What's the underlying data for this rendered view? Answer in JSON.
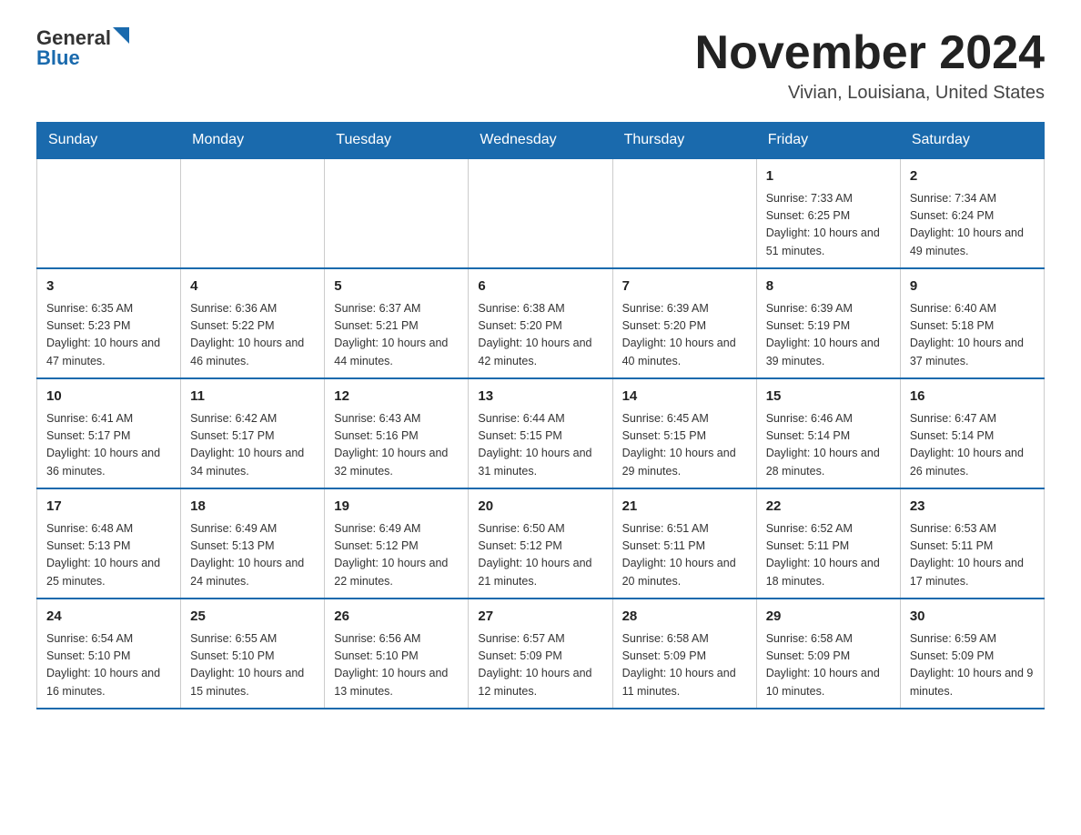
{
  "header": {
    "logo": {
      "general": "General",
      "blue": "Blue",
      "alt": "GeneralBlue logo"
    },
    "title": "November 2024",
    "location": "Vivian, Louisiana, United States"
  },
  "calendar": {
    "days_of_week": [
      "Sunday",
      "Monday",
      "Tuesday",
      "Wednesday",
      "Thursday",
      "Friday",
      "Saturday"
    ],
    "weeks": [
      [
        {
          "day": "",
          "info": ""
        },
        {
          "day": "",
          "info": ""
        },
        {
          "day": "",
          "info": ""
        },
        {
          "day": "",
          "info": ""
        },
        {
          "day": "",
          "info": ""
        },
        {
          "day": "1",
          "info": "Sunrise: 7:33 AM\nSunset: 6:25 PM\nDaylight: 10 hours and 51 minutes."
        },
        {
          "day": "2",
          "info": "Sunrise: 7:34 AM\nSunset: 6:24 PM\nDaylight: 10 hours and 49 minutes."
        }
      ],
      [
        {
          "day": "3",
          "info": "Sunrise: 6:35 AM\nSunset: 5:23 PM\nDaylight: 10 hours and 47 minutes."
        },
        {
          "day": "4",
          "info": "Sunrise: 6:36 AM\nSunset: 5:22 PM\nDaylight: 10 hours and 46 minutes."
        },
        {
          "day": "5",
          "info": "Sunrise: 6:37 AM\nSunset: 5:21 PM\nDaylight: 10 hours and 44 minutes."
        },
        {
          "day": "6",
          "info": "Sunrise: 6:38 AM\nSunset: 5:20 PM\nDaylight: 10 hours and 42 minutes."
        },
        {
          "day": "7",
          "info": "Sunrise: 6:39 AM\nSunset: 5:20 PM\nDaylight: 10 hours and 40 minutes."
        },
        {
          "day": "8",
          "info": "Sunrise: 6:39 AM\nSunset: 5:19 PM\nDaylight: 10 hours and 39 minutes."
        },
        {
          "day": "9",
          "info": "Sunrise: 6:40 AM\nSunset: 5:18 PM\nDaylight: 10 hours and 37 minutes."
        }
      ],
      [
        {
          "day": "10",
          "info": "Sunrise: 6:41 AM\nSunset: 5:17 PM\nDaylight: 10 hours and 36 minutes."
        },
        {
          "day": "11",
          "info": "Sunrise: 6:42 AM\nSunset: 5:17 PM\nDaylight: 10 hours and 34 minutes."
        },
        {
          "day": "12",
          "info": "Sunrise: 6:43 AM\nSunset: 5:16 PM\nDaylight: 10 hours and 32 minutes."
        },
        {
          "day": "13",
          "info": "Sunrise: 6:44 AM\nSunset: 5:15 PM\nDaylight: 10 hours and 31 minutes."
        },
        {
          "day": "14",
          "info": "Sunrise: 6:45 AM\nSunset: 5:15 PM\nDaylight: 10 hours and 29 minutes."
        },
        {
          "day": "15",
          "info": "Sunrise: 6:46 AM\nSunset: 5:14 PM\nDaylight: 10 hours and 28 minutes."
        },
        {
          "day": "16",
          "info": "Sunrise: 6:47 AM\nSunset: 5:14 PM\nDaylight: 10 hours and 26 minutes."
        }
      ],
      [
        {
          "day": "17",
          "info": "Sunrise: 6:48 AM\nSunset: 5:13 PM\nDaylight: 10 hours and 25 minutes."
        },
        {
          "day": "18",
          "info": "Sunrise: 6:49 AM\nSunset: 5:13 PM\nDaylight: 10 hours and 24 minutes."
        },
        {
          "day": "19",
          "info": "Sunrise: 6:49 AM\nSunset: 5:12 PM\nDaylight: 10 hours and 22 minutes."
        },
        {
          "day": "20",
          "info": "Sunrise: 6:50 AM\nSunset: 5:12 PM\nDaylight: 10 hours and 21 minutes."
        },
        {
          "day": "21",
          "info": "Sunrise: 6:51 AM\nSunset: 5:11 PM\nDaylight: 10 hours and 20 minutes."
        },
        {
          "day": "22",
          "info": "Sunrise: 6:52 AM\nSunset: 5:11 PM\nDaylight: 10 hours and 18 minutes."
        },
        {
          "day": "23",
          "info": "Sunrise: 6:53 AM\nSunset: 5:11 PM\nDaylight: 10 hours and 17 minutes."
        }
      ],
      [
        {
          "day": "24",
          "info": "Sunrise: 6:54 AM\nSunset: 5:10 PM\nDaylight: 10 hours and 16 minutes."
        },
        {
          "day": "25",
          "info": "Sunrise: 6:55 AM\nSunset: 5:10 PM\nDaylight: 10 hours and 15 minutes."
        },
        {
          "day": "26",
          "info": "Sunrise: 6:56 AM\nSunset: 5:10 PM\nDaylight: 10 hours and 13 minutes."
        },
        {
          "day": "27",
          "info": "Sunrise: 6:57 AM\nSunset: 5:09 PM\nDaylight: 10 hours and 12 minutes."
        },
        {
          "day": "28",
          "info": "Sunrise: 6:58 AM\nSunset: 5:09 PM\nDaylight: 10 hours and 11 minutes."
        },
        {
          "day": "29",
          "info": "Sunrise: 6:58 AM\nSunset: 5:09 PM\nDaylight: 10 hours and 10 minutes."
        },
        {
          "day": "30",
          "info": "Sunrise: 6:59 AM\nSunset: 5:09 PM\nDaylight: 10 hours and 9 minutes."
        }
      ]
    ]
  }
}
